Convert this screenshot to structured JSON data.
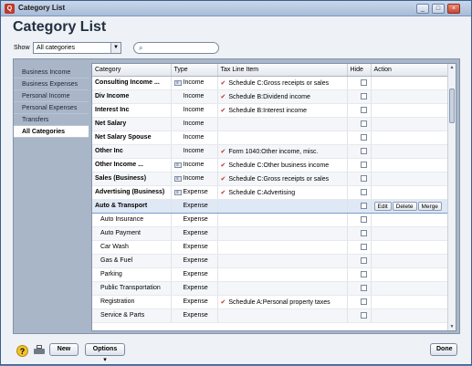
{
  "window": {
    "title": "Category List",
    "icon": "Q"
  },
  "page_title": "Category List",
  "filter": {
    "show_label": "Show",
    "selected": "All categories",
    "search_placeholder": ""
  },
  "sidebar": {
    "items": [
      {
        "label": "Business Income",
        "active": false
      },
      {
        "label": "Business Expenses",
        "active": false
      },
      {
        "label": "Personal Income",
        "active": false
      },
      {
        "label": "Personal Expenses",
        "active": false
      },
      {
        "label": "Transfers",
        "active": false
      },
      {
        "label": "All Categories",
        "active": true
      }
    ]
  },
  "table": {
    "columns": [
      "Category",
      "Type",
      "Tax Line Item",
      "Hide",
      "Action"
    ],
    "rows": [
      {
        "category": "Consulting Income ...",
        "type": "Income",
        "split": true,
        "tax": "Schedule C:Gross receipts or sales",
        "level": "parent"
      },
      {
        "category": "Div Income",
        "type": "Income",
        "split": false,
        "tax": "Schedule B:Dividend income",
        "level": "parent"
      },
      {
        "category": "Interest Inc",
        "type": "Income",
        "split": false,
        "tax": "Schedule B:Interest income",
        "level": "parent"
      },
      {
        "category": "Net Salary",
        "type": "Income",
        "split": false,
        "tax": "",
        "level": "parent"
      },
      {
        "category": "Net Salary Spouse",
        "type": "Income",
        "split": false,
        "tax": "",
        "level": "parent"
      },
      {
        "category": "Other Inc",
        "type": "Income",
        "split": false,
        "tax": "Form 1040:Other income, misc.",
        "level": "parent"
      },
      {
        "category": "Other Income ...",
        "type": "Income",
        "split": true,
        "tax": "Schedule C:Other business income",
        "level": "parent"
      },
      {
        "category": "Sales (Business)",
        "type": "Income",
        "split": true,
        "tax": "Schedule C:Gross receipts or sales",
        "level": "parent"
      },
      {
        "category": "Advertising (Business)",
        "type": "Expense",
        "split": true,
        "tax": "Schedule C:Advertising",
        "level": "parent"
      },
      {
        "category": "Auto & Transport",
        "type": "Expense",
        "split": false,
        "tax": "",
        "level": "parent",
        "selected": true
      },
      {
        "category": "Auto Insurance",
        "type": "Expense",
        "split": false,
        "tax": "",
        "level": "child"
      },
      {
        "category": "Auto Payment",
        "type": "Expense",
        "split": false,
        "tax": "",
        "level": "child"
      },
      {
        "category": "Car Wash",
        "type": "Expense",
        "split": false,
        "tax": "",
        "level": "child"
      },
      {
        "category": "Gas & Fuel",
        "type": "Expense",
        "split": false,
        "tax": "",
        "level": "child"
      },
      {
        "category": "Parking",
        "type": "Expense",
        "split": false,
        "tax": "",
        "level": "child"
      },
      {
        "category": "Public Transportation",
        "type": "Expense",
        "split": false,
        "tax": "",
        "level": "child"
      },
      {
        "category": "Registration",
        "type": "Expense",
        "split": false,
        "tax": "Schedule A:Personal property taxes",
        "level": "child"
      },
      {
        "category": "Service & Parts",
        "type": "Expense",
        "split": false,
        "tax": "",
        "level": "child"
      }
    ],
    "row_actions": [
      "Edit",
      "Delete",
      "Merge"
    ]
  },
  "footer": {
    "new_label": "New",
    "options_label": "Options",
    "done_label": "Done"
  },
  "colors": {
    "accent": "#5a7fb0",
    "selection": "#dfe8f5",
    "tax_check": "#b8322b"
  }
}
